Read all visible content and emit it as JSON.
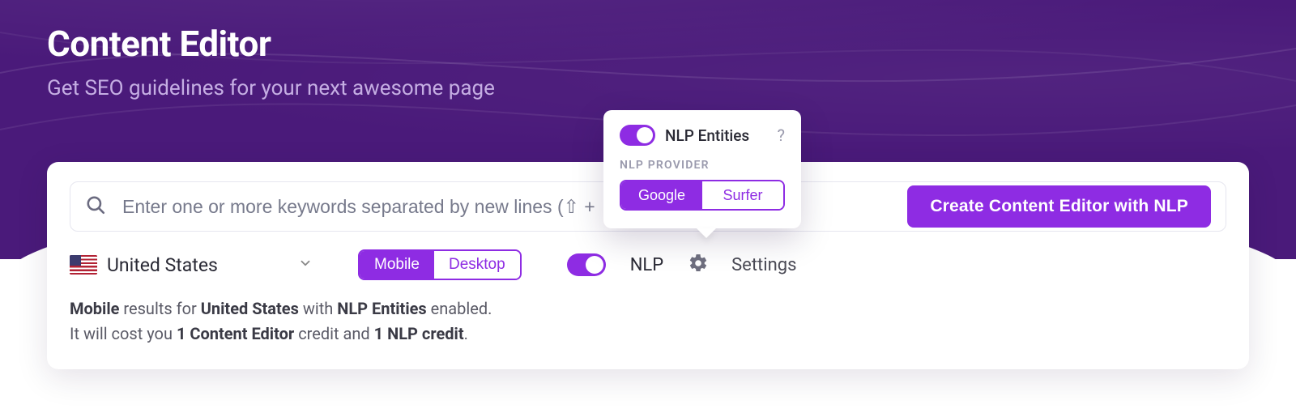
{
  "header": {
    "title": "Content Editor",
    "subtitle": "Get SEO guidelines for your next awesome page"
  },
  "search": {
    "placeholder": "Enter one or more keywords separated by new lines (⇧ +",
    "cta_label": "Create Content Editor with NLP"
  },
  "controls": {
    "country": "United States",
    "device_segments": {
      "mobile": "Mobile",
      "desktop": "Desktop"
    },
    "device_selected": "mobile",
    "nlp_label": "NLP",
    "nlp_enabled": true,
    "settings_label": "Settings"
  },
  "popover": {
    "toggle_label": "NLP Entities",
    "toggle_on": true,
    "section_label": "NLP PROVIDER",
    "providers": {
      "google": "Google",
      "surfer": "Surfer"
    },
    "provider_selected": "google"
  },
  "info": {
    "line1_prefix": "",
    "line1_b1": "Mobile",
    "line1_mid1": " results for ",
    "line1_b2": "United States",
    "line1_mid2": " with ",
    "line1_b3": "NLP Entities",
    "line1_suffix": " enabled.",
    "line2_prefix": "It will cost you ",
    "line2_b1": "1 Content Editor",
    "line2_mid": " credit and ",
    "line2_b2": "1 NLP credit",
    "line2_suffix": "."
  }
}
